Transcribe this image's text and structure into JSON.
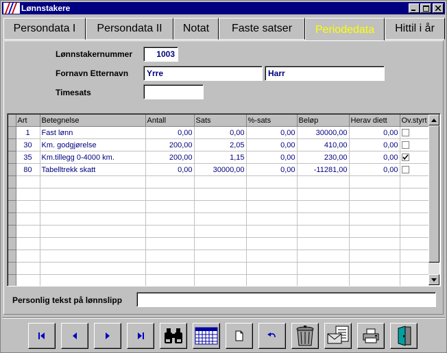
{
  "window": {
    "title": "Lønnstakere"
  },
  "tabs": [
    {
      "label": "Persondata I",
      "active": false
    },
    {
      "label": "Persondata II",
      "active": false
    },
    {
      "label": "Notat",
      "active": false
    },
    {
      "label": "Faste satser",
      "active": false
    },
    {
      "label": "Periodedata",
      "active": true
    },
    {
      "label": "Hittil i år",
      "active": false
    }
  ],
  "form": {
    "employee_number_label": "Lønnstakernummer",
    "employee_number": "1003",
    "name_label": "Fornavn Etternavn",
    "first_name": "Yrre",
    "last_name": "Harr",
    "hourly_rate_label": "Timesats",
    "hourly_rate": ""
  },
  "grid": {
    "columns": [
      "Art",
      "Betegnelse",
      "Antall",
      "Sats",
      "%-sats",
      "Beløp",
      "Herav diett",
      "Ov.styrt"
    ],
    "rows": [
      {
        "art": "1",
        "betegnelse": "Fast lønn",
        "antall": "0,00",
        "sats": "0,00",
        "pct": "0,00",
        "belop": "30000,00",
        "diett": "0,00",
        "ovstyrt": false
      },
      {
        "art": "30",
        "betegnelse": "Km. godgjørelse",
        "antall": "200,00",
        "sats": "2,05",
        "pct": "0,00",
        "belop": "410,00",
        "diett": "0,00",
        "ovstyrt": false
      },
      {
        "art": "35",
        "betegnelse": "Km.tillegg 0-4000 km.",
        "antall": "200,00",
        "sats": "1,15",
        "pct": "0,00",
        "belop": "230,00",
        "diett": "0,00",
        "ovstyrt": true
      },
      {
        "art": "80",
        "betegnelse": "Tabelltrekk skatt",
        "antall": "0,00",
        "sats": "30000,00",
        "pct": "0,00",
        "belop": "-11281,00",
        "diett": "0,00",
        "ovstyrt": false
      }
    ],
    "empty_rows": 9
  },
  "payslip": {
    "label": "Personlig tekst på lønnslipp",
    "value": ""
  },
  "toolbar": {
    "buttons": [
      "first-record-icon",
      "previous-record-icon",
      "next-record-icon",
      "last-record-icon",
      "binoculars-icon",
      "calendar-grid-icon",
      "new-document-icon",
      "undo-icon",
      "trash-can-icon",
      "mail-merge-icon",
      "printer-icon",
      "exit-door-icon"
    ]
  },
  "colors": {
    "title_bar": "#000080",
    "active_tab_text": "#ffff00",
    "field_text": "#000080"
  }
}
